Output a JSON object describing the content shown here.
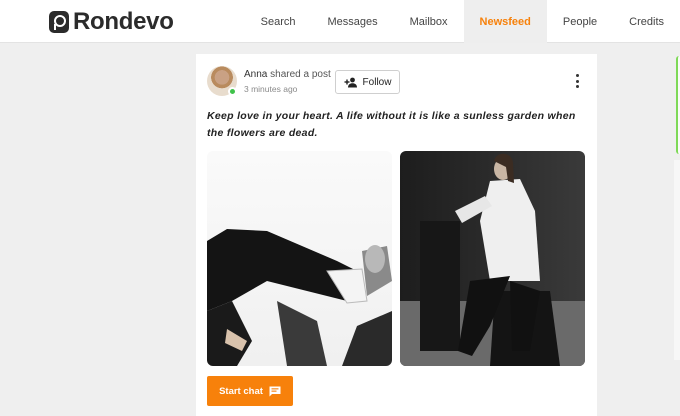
{
  "brand": {
    "name": "Rondevo"
  },
  "nav": {
    "items": [
      {
        "label": "Search"
      },
      {
        "label": "Messages"
      },
      {
        "label": "Mailbox"
      },
      {
        "label": "Newsfeed",
        "active": true
      },
      {
        "label": "People"
      },
      {
        "label": "Credits"
      }
    ]
  },
  "post": {
    "author": "Anna",
    "action": "shared a post",
    "time": "3 minutes ago",
    "follow_label": "Follow",
    "text": "Keep love in your heart. A life without it is like a sunless garden when the flowers are dead.",
    "start_chat_label": "Start chat"
  },
  "colors": {
    "accent": "#f7810b",
    "online": "#3fc24a"
  },
  "icons": [
    "logo-mark-icon",
    "add-person-icon",
    "more-vertical-icon",
    "chat-icon"
  ]
}
